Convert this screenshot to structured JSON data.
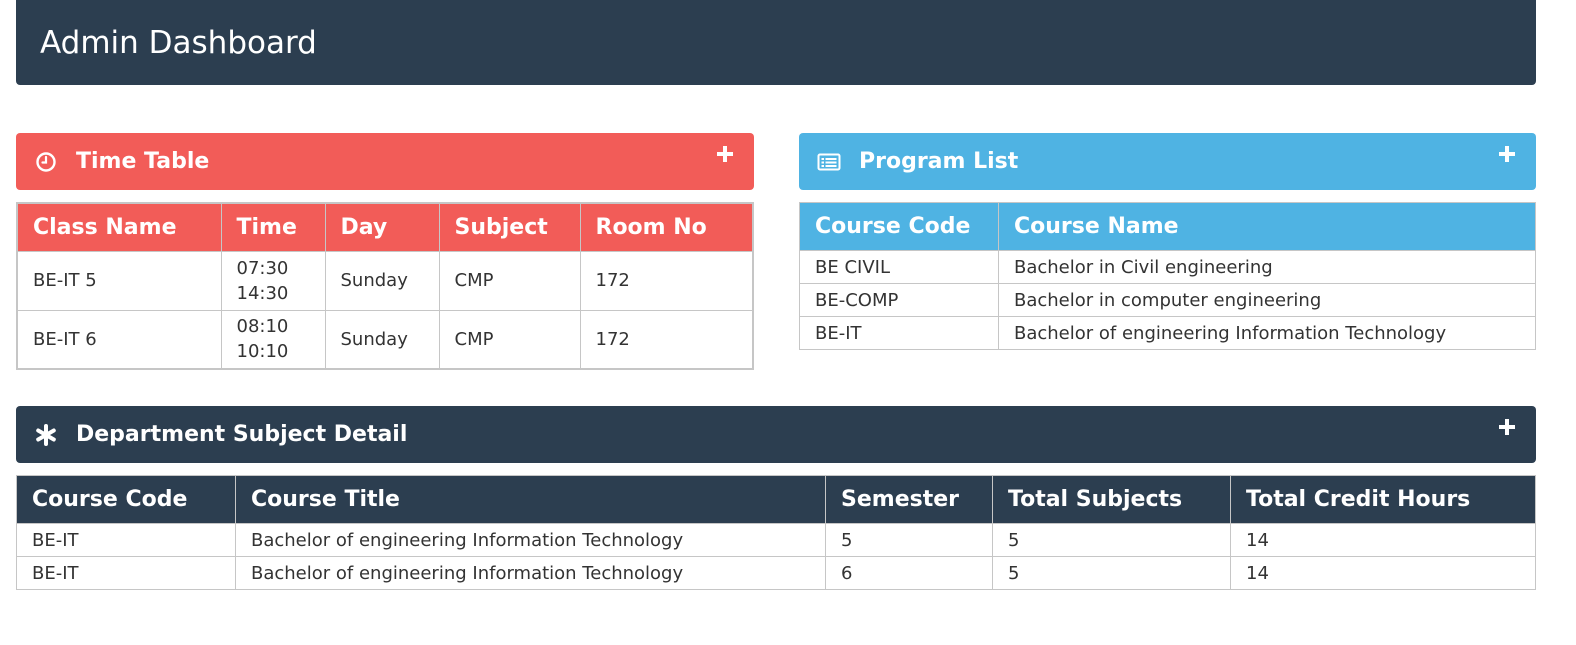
{
  "header": {
    "title": "Admin Dashboard"
  },
  "colors": {
    "red": "#f25c58",
    "blue": "#4fb3e3",
    "navy": "#2c3e50"
  },
  "timetable": {
    "title": "Time Table",
    "icon": "clock-icon",
    "add_icon": "plus-icon",
    "columns": [
      "Class Name",
      "Time",
      "Day",
      "Subject",
      "Room No"
    ],
    "rows": [
      {
        "class_name": "BE-IT 5",
        "time_start": "07:30",
        "time_end": "14:30",
        "day": "Sunday",
        "subject": "CMP",
        "room": "172"
      },
      {
        "class_name": "BE-IT 6",
        "time_start": "08:10",
        "time_end": "10:10",
        "day": "Sunday",
        "subject": "CMP",
        "room": "172"
      }
    ]
  },
  "programs": {
    "title": "Program List",
    "icon": "list-icon",
    "add_icon": "plus-icon",
    "columns": [
      "Course Code",
      "Course Name"
    ],
    "rows": [
      {
        "code": "BE CIVIL",
        "name": "Bachelor in Civil engineering"
      },
      {
        "code": "BE-COMP",
        "name": "Bachelor in computer engineering"
      },
      {
        "code": "BE-IT",
        "name": "Bachelor of engineering Information Technology"
      }
    ]
  },
  "department": {
    "title": "Department Subject Detail",
    "icon": "asterisk-icon",
    "add_icon": "plus-icon",
    "columns": [
      "Course Code",
      "Course Title",
      "Semester",
      "Total Subjects",
      "Total Credit Hours"
    ],
    "rows": [
      {
        "code": "BE-IT",
        "title": "Bachelor of engineering Information Technology",
        "semester": "5",
        "total_subjects": "5",
        "credit_hours": "14"
      },
      {
        "code": "BE-IT",
        "title": "Bachelor of engineering Information Technology",
        "semester": "6",
        "total_subjects": "5",
        "credit_hours": "14"
      }
    ]
  }
}
